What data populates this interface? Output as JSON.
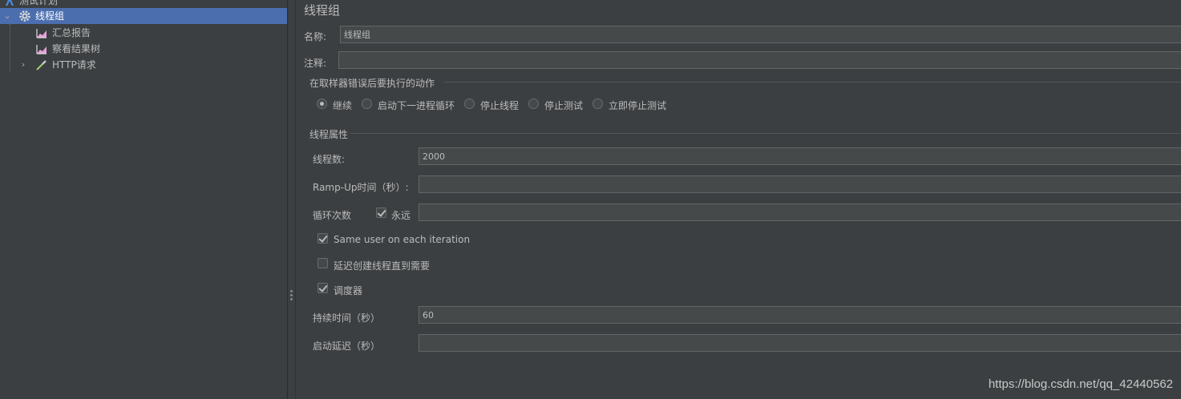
{
  "tree": {
    "items": [
      {
        "label": "测试计划",
        "icon": "test-plan-icon"
      },
      {
        "label": "线程组",
        "icon": "gear-icon",
        "selected": true
      },
      {
        "label": "汇总报告",
        "icon": "chart-icon"
      },
      {
        "label": "察看结果树",
        "icon": "chart-icon"
      },
      {
        "label": "HTTP请求",
        "icon": "pipette-icon"
      }
    ]
  },
  "panel": {
    "title": "线程组",
    "name_label": "名称:",
    "name_value": "线程组",
    "comment_label": "注释:",
    "comment_value": "",
    "error_group_title": "在取样器错误后要执行的动作",
    "error_actions": [
      {
        "label": "继续",
        "checked": true
      },
      {
        "label": "启动下一进程循环",
        "checked": false
      },
      {
        "label": "停止线程",
        "checked": false
      },
      {
        "label": "停止测试",
        "checked": false
      },
      {
        "label": "立即停止测试",
        "checked": false
      }
    ],
    "thread_group_title": "线程属性",
    "threads_label": "线程数:",
    "threads_value": "2000",
    "rampup_label": "Ramp-Up时间（秒）:",
    "rampup_value": "",
    "loop_label": "循环次数",
    "forever_label": "永远",
    "forever_checked": true,
    "loop_value": "",
    "same_user_label": "Same user on each iteration",
    "same_user_checked": true,
    "delay_create_label": "延迟创建线程直到需要",
    "delay_create_checked": false,
    "scheduler_label": "调度器",
    "scheduler_checked": true,
    "duration_label": "持续时间（秒）",
    "duration_value": "60",
    "startup_delay_label": "启动延迟（秒）",
    "startup_delay_value": ""
  },
  "watermark": "https://blog.csdn.net/qq_42440562"
}
